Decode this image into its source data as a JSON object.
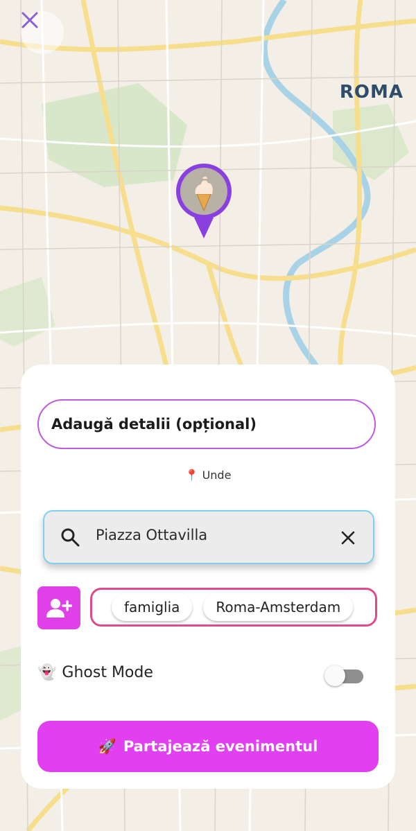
{
  "map": {
    "city_label": "ROMA"
  },
  "event_pin": {
    "icon": "ice-cream-icon",
    "color": "#8a3fe0"
  },
  "form": {
    "details_placeholder": "Adaugă detalii (opțional)",
    "where_icon": "📍",
    "where_label": "Unde",
    "search": {
      "value": "Piazza Ottavilla"
    },
    "groups": [
      {
        "label": "famiglia"
      },
      {
        "label": "Roma-Amsterdam"
      }
    ],
    "ghost_mode": {
      "icon": "👻",
      "label": "Ghost Mode",
      "enabled": false
    },
    "share_button": {
      "icon": "🚀",
      "label": "Partajează evenimentul"
    }
  },
  "colors": {
    "accent": "#e040f0",
    "details_border": "#c05adf",
    "groups_border": "#e04a8a",
    "search_border": "#7fd0f0"
  }
}
